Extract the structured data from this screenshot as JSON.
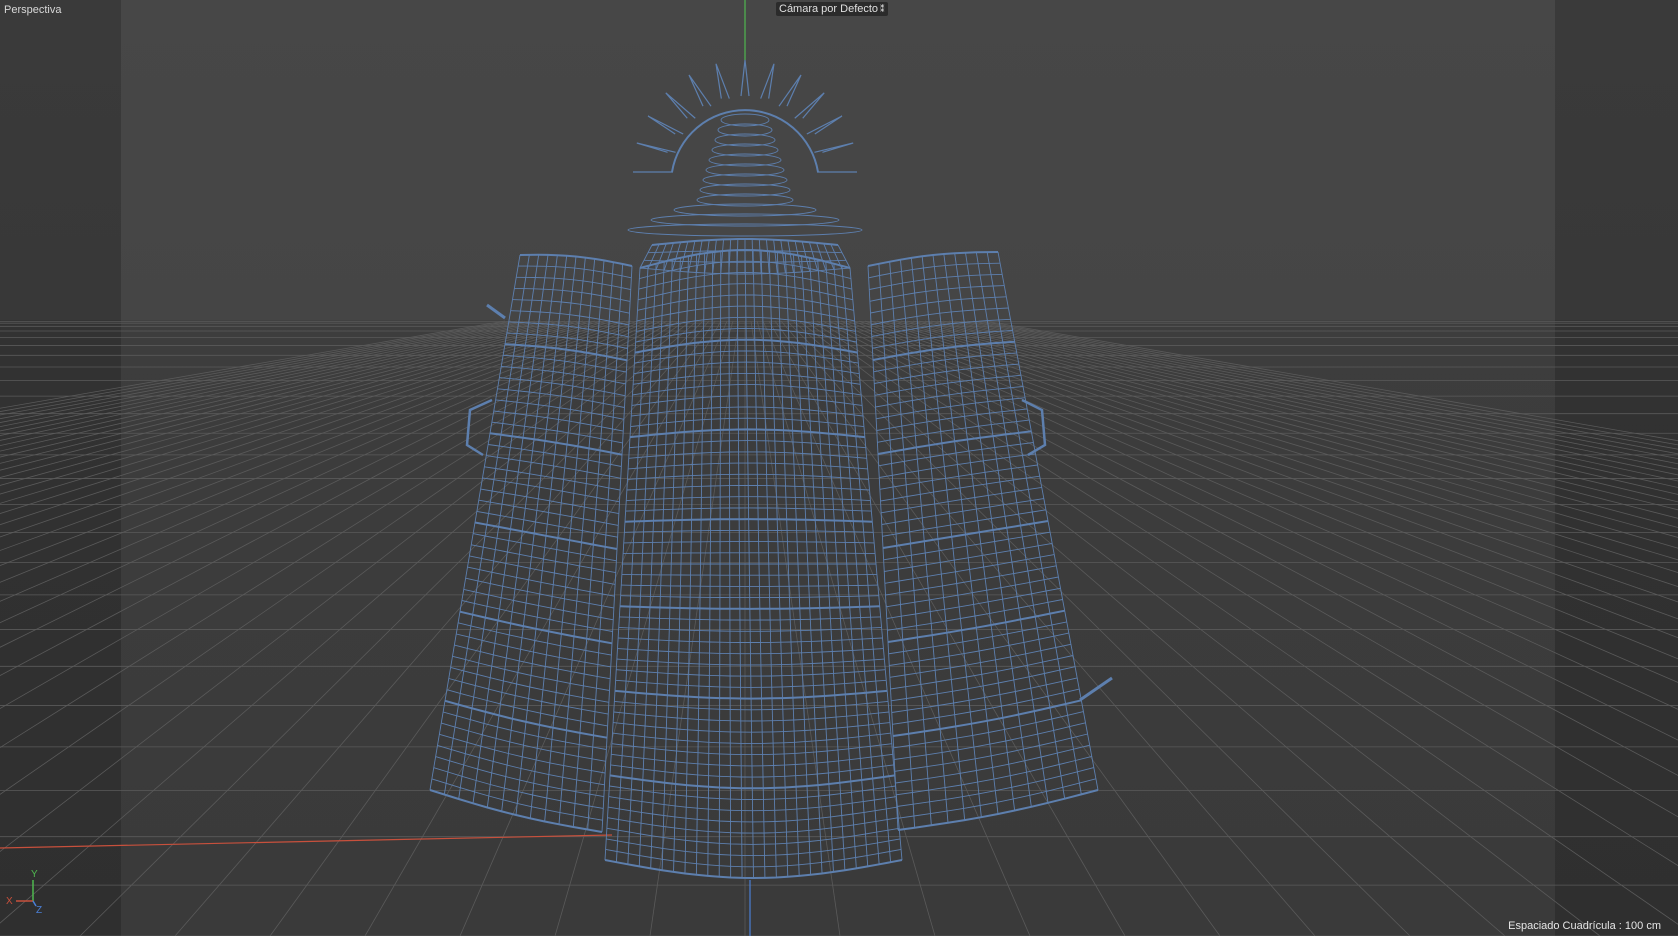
{
  "viewport": {
    "view_name": "Perspectiva",
    "camera_label": "Cámara por Defecto",
    "camera_icon": "camera-options-icon",
    "grid_spacing_label": "Espaciado Cuadrícula : 100 cm"
  },
  "axis_gizmo": {
    "x": "X",
    "y": "Y",
    "z": "Z"
  },
  "colors": {
    "wireframe": "#5d7fae",
    "grid": "#5a5a5a",
    "axis_x": "#c8503c",
    "axis_y": "#4fb84f",
    "axis_z": "#4a7fd6",
    "background": "#474747"
  },
  "scene": {
    "object": "wireframe-model",
    "display_mode": "wireframe"
  }
}
